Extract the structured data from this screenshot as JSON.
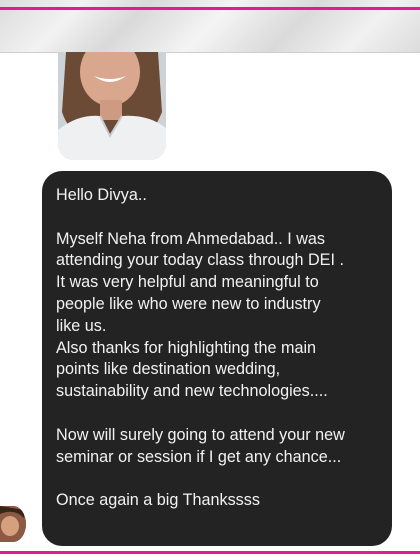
{
  "conversation": {
    "message": {
      "lines": [
        "Hello Divya..",
        "",
        "Myself Neha from Ahmedabad.. I was",
        "attending your today class through DEI .",
        "It was very helpful and meaningful to",
        "people like who were new to industry",
        "like us.",
        "Also thanks for highlighting the main",
        "points like destination wedding,",
        "sustainability and new technologies....",
        "",
        "Now will surely going to attend your new",
        "seminar or session if I get any chance...",
        "",
        "Once again a big Thankssss"
      ]
    }
  },
  "colors": {
    "accent": "#e01d8a",
    "bubble": "#232323",
    "text": "#f2f2f2"
  }
}
